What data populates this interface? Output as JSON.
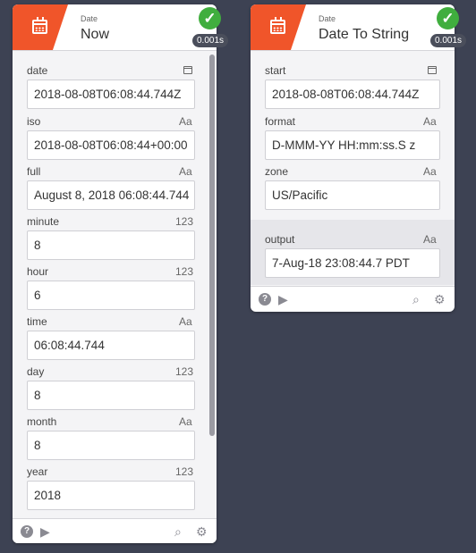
{
  "nodes": {
    "now": {
      "kind": "Date",
      "title": "Now",
      "timing": "0.001s",
      "status_icon": "check-icon",
      "fields": [
        {
          "label": "date",
          "type_icon": "calendar-icon",
          "value": "2018-08-08T06:08:44.744Z"
        },
        {
          "label": "iso",
          "type": "Aa",
          "value": "2018-08-08T06:08:44+00:00"
        },
        {
          "label": "full",
          "type": "Aa",
          "value": "August 8, 2018 06:08:44.744"
        },
        {
          "label": "minute",
          "type": "123",
          "value": "8"
        },
        {
          "label": "hour",
          "type": "123",
          "value": "6"
        },
        {
          "label": "time",
          "type": "Aa",
          "value": "06:08:44.744"
        },
        {
          "label": "day",
          "type": "123",
          "value": "8"
        },
        {
          "label": "month",
          "type": "Aa",
          "value": "8"
        },
        {
          "label": "year",
          "type": "123",
          "value": "2018"
        }
      ]
    },
    "date_to_string": {
      "kind": "Date",
      "title": "Date To String",
      "timing": "0.001s",
      "status_icon": "check-icon",
      "inputs": [
        {
          "label": "start",
          "type_icon": "calendar-icon",
          "value": "2018-08-08T06:08:44.744Z"
        },
        {
          "label": "format",
          "type": "Aa",
          "value": "D-MMM-YY HH:mm:ss.S z"
        },
        {
          "label": "zone",
          "type": "Aa",
          "value": "US/Pacific"
        }
      ],
      "output": {
        "label": "output",
        "type": "Aa",
        "value": "7-Aug-18 23:08:44.7 PDT"
      }
    }
  },
  "footer_icons": [
    "help-icon",
    "play-icon",
    "search-icon",
    "gear-icon"
  ],
  "colors": {
    "background": "#3d4253",
    "accent": "#f0552a",
    "success": "#40ae3e"
  }
}
